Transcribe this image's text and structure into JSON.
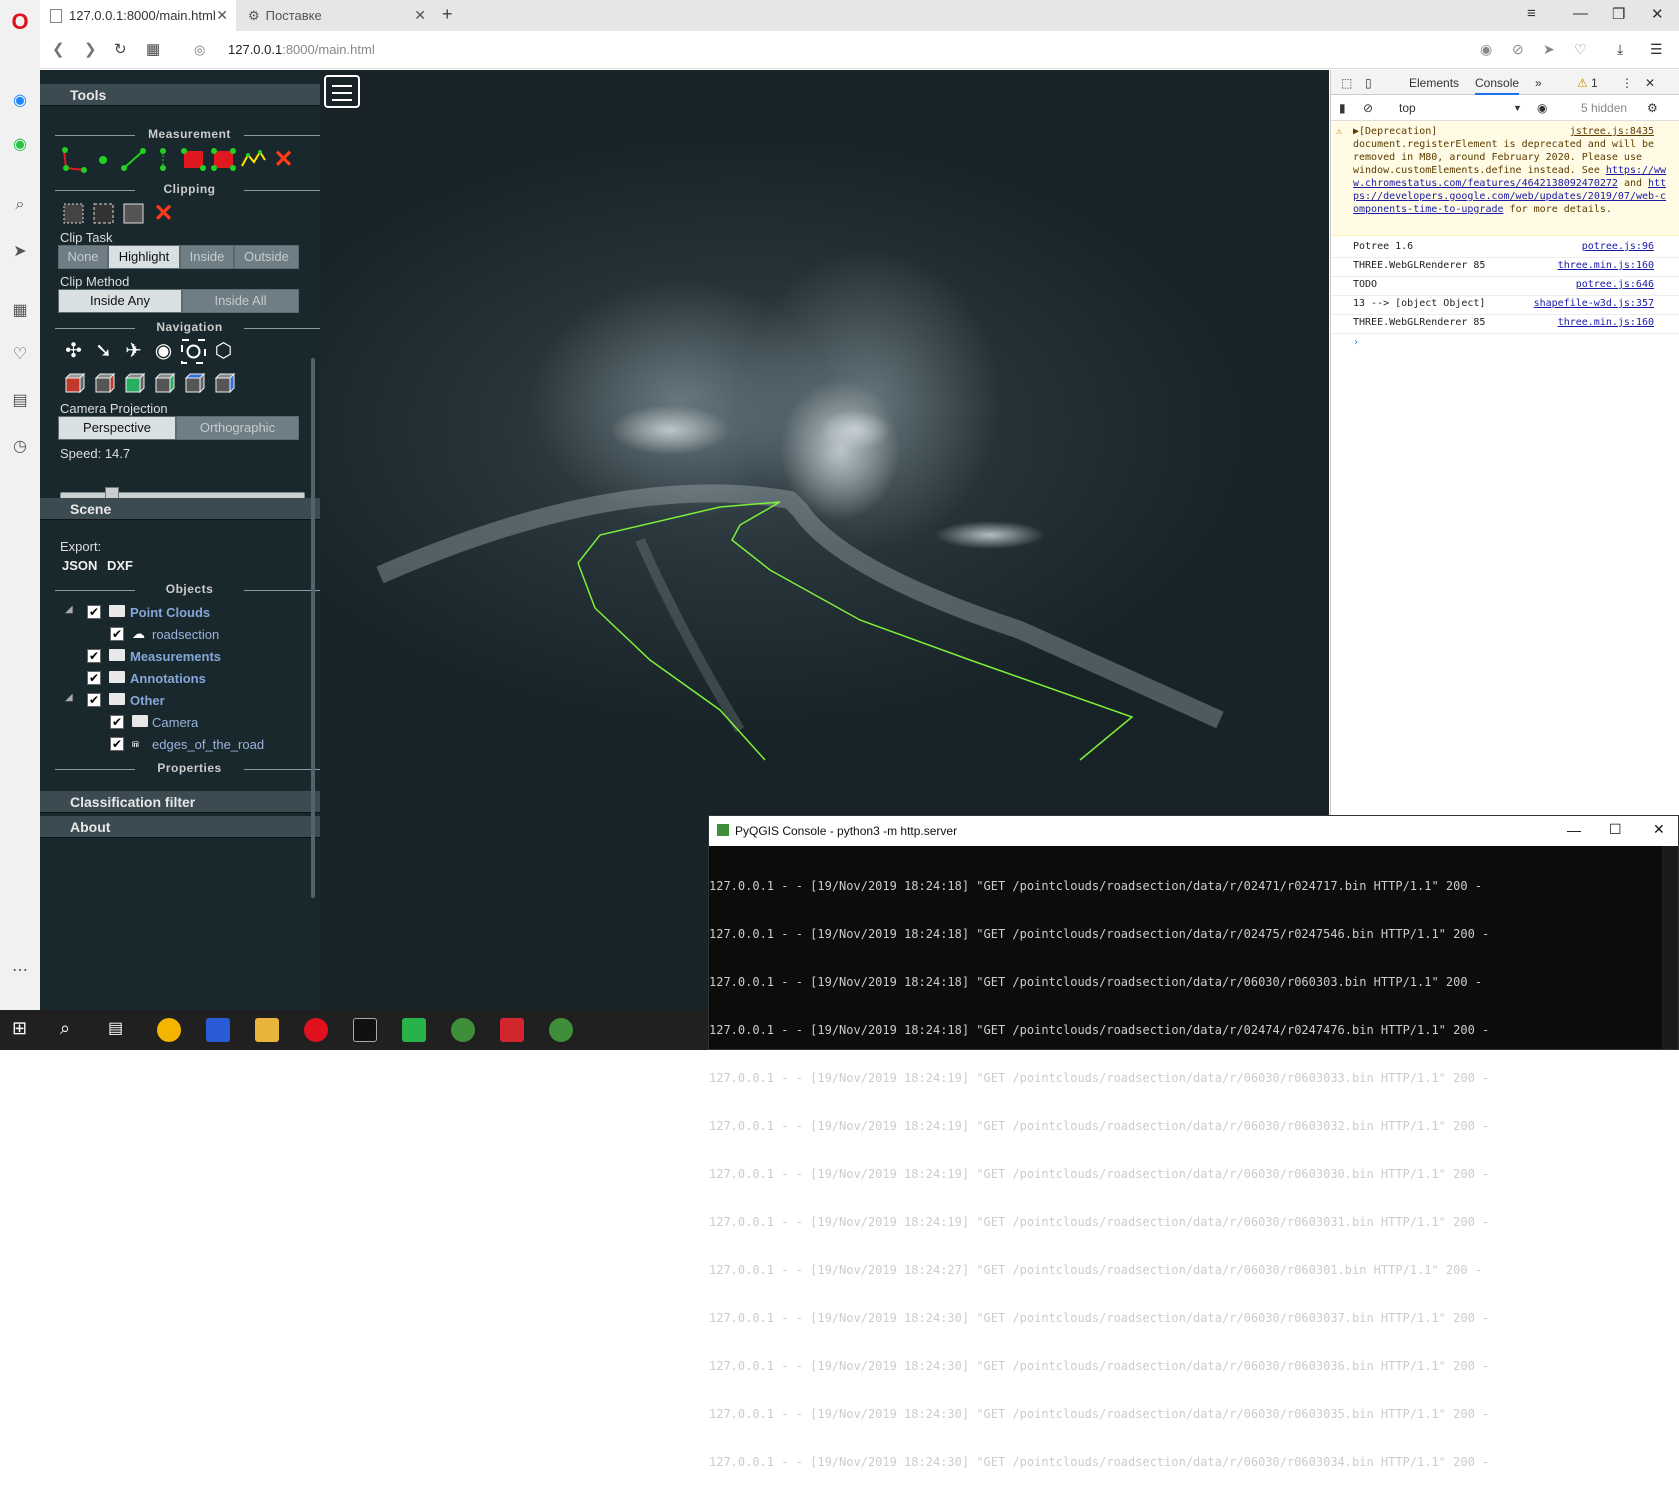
{
  "browser": {
    "tabs": [
      {
        "title": "127.0.0.1:8000/main.html"
      },
      {
        "title": "Поставке"
      }
    ],
    "url_host": "127.0.0.1",
    "url_rest": ":8000/main.html"
  },
  "sidebar": {
    "tools_header": "Tools",
    "measurement": "Measurement",
    "clipping": "Clipping",
    "clip_task_label": "Clip Task",
    "clip_task": [
      "None",
      "Highlight",
      "Inside",
      "Outside"
    ],
    "clip_task_selected": "Highlight",
    "clip_method_label": "Clip Method",
    "clip_method": [
      "Inside Any",
      "Inside All"
    ],
    "clip_method_selected": "Inside Any",
    "navigation": "Navigation",
    "camera_projection_label": "Camera Projection",
    "camera_projection": [
      "Perspective",
      "Orthographic"
    ],
    "camera_projection_selected": "Perspective",
    "speed_label": "Speed: 14.7",
    "speed_fraction": 0.19,
    "scene_header": "Scene",
    "export_label": "Export:",
    "export_json": "JSON",
    "export_dxf": "DXF",
    "objects": "Objects",
    "tree": [
      {
        "label": "Point Clouds",
        "bold": true
      },
      {
        "label": "roadsection",
        "bold": false
      },
      {
        "label": "Measurements",
        "bold": true
      },
      {
        "label": "Annotations",
        "bold": true
      },
      {
        "label": "Other",
        "bold": true
      },
      {
        "label": "Camera",
        "bold": false
      },
      {
        "label": "edges_of_the_road",
        "bold": false
      }
    ],
    "properties": "Properties",
    "classification_header": "Classification filter",
    "about_header": "About"
  },
  "devtools": {
    "tab_elements": "Elements",
    "tab_console": "Console",
    "warning_count": "1",
    "context": "top",
    "hidden": "5 hidden",
    "warning_text_1": "▶[Deprecation]",
    "warning_src": "jstree.js:8435",
    "warning_text_2": "document.registerElement is deprecated and will be removed in M80, around February 2020. Please use window.customElements.define instead. See",
    "warning_link_1": "https://www.chromestatus.com/features/4642138092470272",
    "warning_and": "and",
    "warning_link_2": "https://developers.google.com/web/updates/2019/07/web-components-time-to-upgrade",
    "warning_tail": "for more details.",
    "logs": [
      {
        "text": "Potree 1.6",
        "src": "potree.js:96"
      },
      {
        "text": "THREE.WebGLRenderer 85",
        "src": "three.min.js:160"
      },
      {
        "text": "TODO",
        "src": "potree.js:646"
      },
      {
        "text": "13 --> [object Object]",
        "src": "shapefile-w3d.js:357"
      },
      {
        "text": "THREE.WebGLRenderer 85",
        "src": "three.min.js:160"
      }
    ],
    "prompt": "›"
  },
  "pyqgis": {
    "title": "PyQGIS Console - python3  -m http.server",
    "lines": [
      "127.0.0.1 - - [19/Nov/2019 18:24:18] \"GET /pointclouds/roadsection/data/r/02471/r024717.bin HTTP/1.1\" 200 -",
      "127.0.0.1 - - [19/Nov/2019 18:24:18] \"GET /pointclouds/roadsection/data/r/02475/r0247546.bin HTTP/1.1\" 200 -",
      "127.0.0.1 - - [19/Nov/2019 18:24:18] \"GET /pointclouds/roadsection/data/r/06030/r060303.bin HTTP/1.1\" 200 -",
      "127.0.0.1 - - [19/Nov/2019 18:24:18] \"GET /pointclouds/roadsection/data/r/02474/r0247476.bin HTTP/1.1\" 200 -",
      "127.0.0.1 - - [19/Nov/2019 18:24:19] \"GET /pointclouds/roadsection/data/r/06030/r0603033.bin HTTP/1.1\" 200 -",
      "127.0.0.1 - - [19/Nov/2019 18:24:19] \"GET /pointclouds/roadsection/data/r/06030/r0603032.bin HTTP/1.1\" 200 -",
      "127.0.0.1 - - [19/Nov/2019 18:24:19] \"GET /pointclouds/roadsection/data/r/06030/r0603030.bin HTTP/1.1\" 200 -",
      "127.0.0.1 - - [19/Nov/2019 18:24:19] \"GET /pointclouds/roadsection/data/r/06030/r0603031.bin HTTP/1.1\" 200 -",
      "127.0.0.1 - - [19/Nov/2019 18:24:27] \"GET /pointclouds/roadsection/data/r/06030/r060301.bin HTTP/1.1\" 200 -",
      "127.0.0.1 - - [19/Nov/2019 18:24:30] \"GET /pointclouds/roadsection/data/r/06030/r0603037.bin HTTP/1.1\" 200 -",
      "127.0.0.1 - - [19/Nov/2019 18:24:30] \"GET /pointclouds/roadsection/data/r/06030/r0603036.bin HTTP/1.1\" 200 -",
      "127.0.0.1 - - [19/Nov/2019 18:24:30] \"GET /pointclouds/roadsection/data/r/06030/r0603035.bin HTTP/1.1\" 200 -",
      "127.0.0.1 - - [19/Nov/2019 18:24:30] \"GET /pointclouds/roadsection/data/r/06030/r0603034.bin HTTP/1.1\" 200 -"
    ]
  },
  "colors": {
    "road_edge": "#7cf03a",
    "panel": "#19282c",
    "accordion": "#3c4b51"
  }
}
